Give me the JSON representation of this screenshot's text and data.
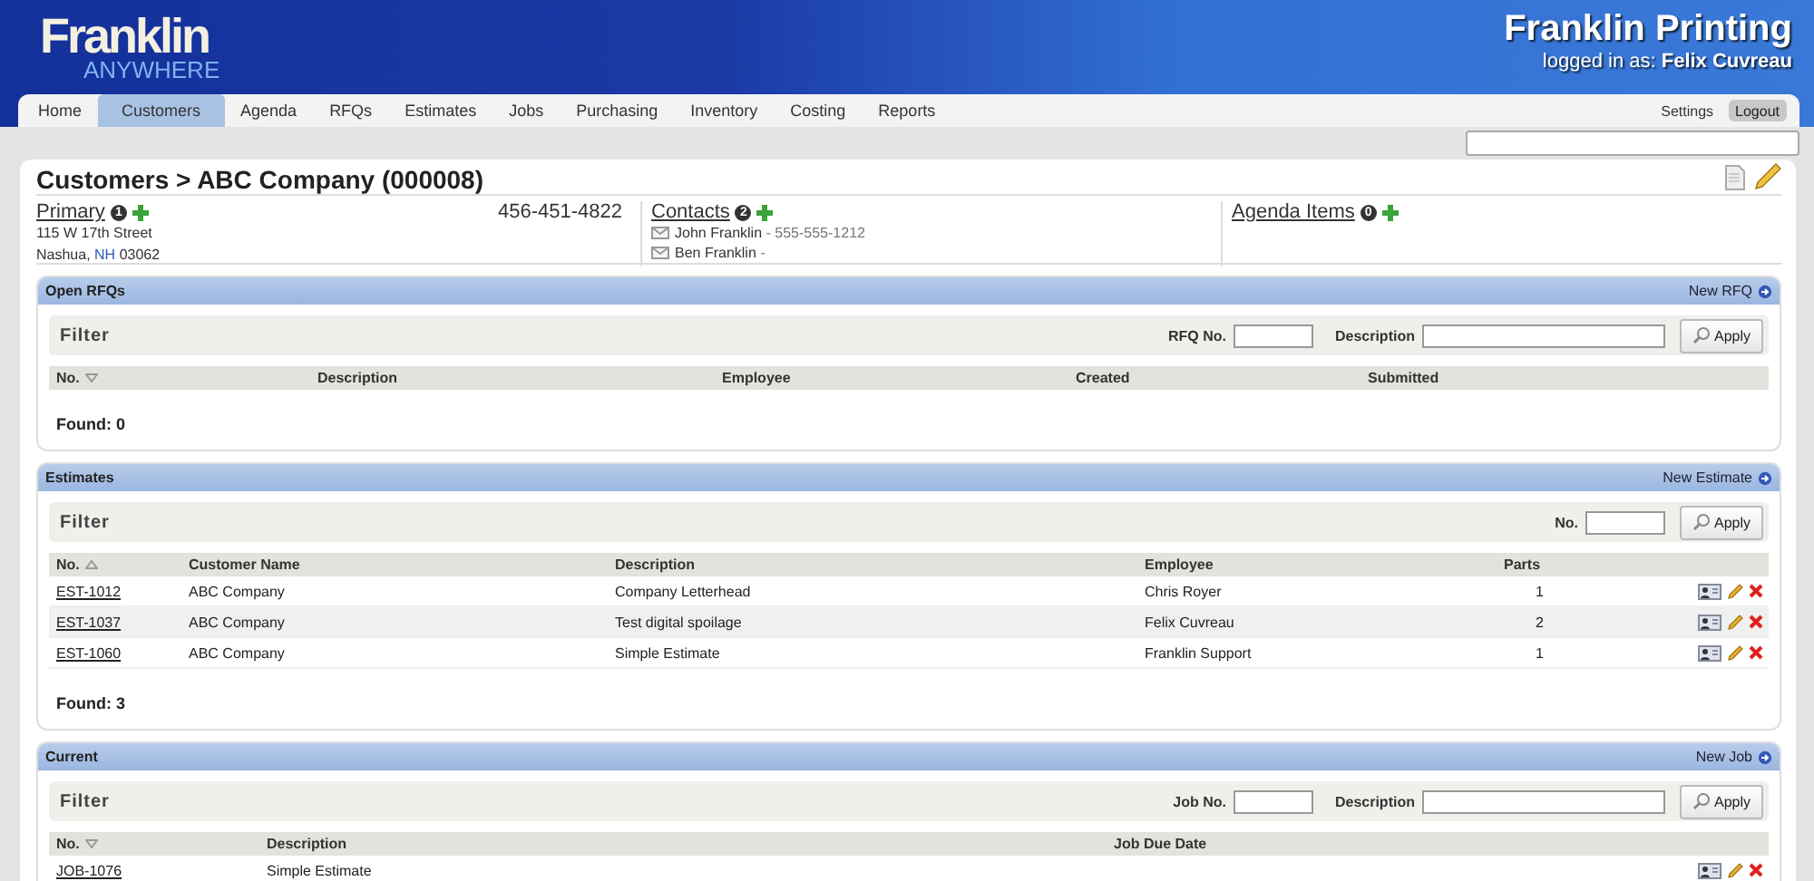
{
  "header": {
    "logo_top": "Franklin",
    "logo_bottom": "ANYWHERE",
    "company": "Franklin Printing",
    "login": "logged in as: **Felix Cuvreau**"
  },
  "nav": {
    "tabs": [
      {
        "label": "Home",
        "selected": false
      },
      {
        "label": "Customers",
        "selected": true
      },
      {
        "label": "Agenda",
        "selected": false
      },
      {
        "label": "RFQs",
        "selected": false
      },
      {
        "label": "Estimates",
        "selected": false
      },
      {
        "label": "Jobs",
        "selected": false
      },
      {
        "label": "Purchasing",
        "selected": false
      },
      {
        "label": "Inventory",
        "selected": false
      },
      {
        "label": "Costing",
        "selected": false
      },
      {
        "label": "Reports",
        "selected": false
      }
    ],
    "settings": "Settings",
    "logout": "Logout"
  },
  "page_title": "Customers > ABC Company (000008)",
  "primary": {
    "label": "Primary",
    "count": "1",
    "address_line1": "115 W 17th Street",
    "city": "Nashua, ",
    "state": "NH",
    "zip": " 03062",
    "phone": "456-451-4822"
  },
  "contacts": {
    "label": "Contacts",
    "count": "2",
    "items": [
      {
        "name": "John Franklin",
        "phone": " - 555-555-1212"
      },
      {
        "name": "Ben Franklin",
        "phone": " -"
      }
    ]
  },
  "agenda": {
    "label": "Agenda Items",
    "count": "0"
  },
  "sections": [
    {
      "kind": "rfq",
      "title": "Open RFQs",
      "action": "New RFQ",
      "filter_title": "Filter",
      "fields": [
        {
          "label": "RFQ No."
        },
        {
          "label": "Description"
        }
      ],
      "apply": "Apply",
      "columns": [
        {
          "label": "No.",
          "sorted_ascending": false
        },
        {
          "label": "Description"
        },
        {
          "label": "Employee"
        },
        {
          "label": "Created"
        },
        {
          "label": "Submitted"
        }
      ],
      "found": "Found: 0"
    },
    {
      "kind": "estimate",
      "title": "Estimates",
      "action": "New Estimate",
      "filter_title": "Filter",
      "fields": [
        {
          "label": "No."
        }
      ],
      "apply": "Apply",
      "columns": [
        {
          "label": "No.",
          "sorted_ascending": true
        },
        {
          "label": "Customer Name"
        },
        {
          "label": "Description"
        },
        {
          "label": "Employee"
        },
        {
          "label": "Parts"
        }
      ],
      "rows": [
        {
          "cells": [
            "EST-1012",
            "ABC Company",
            "Company Letterhead",
            "Chris Royer",
            "1"
          ]
        },
        {
          "cells": [
            "EST-1037",
            "ABC Company",
            "Test digital spoilage",
            "Felix Cuvreau",
            "2"
          ]
        },
        {
          "cells": [
            "EST-1060",
            "ABC Company",
            "Simple Estimate",
            "Franklin Support",
            "1"
          ]
        }
      ],
      "found": "Found: 3"
    },
    {
      "kind": "job",
      "title": "Current",
      "action": "New Job",
      "filter_title": "Filter",
      "fields": [
        {
          "label": "Job No."
        },
        {
          "label": "Description"
        }
      ],
      "apply": "Apply",
      "columns": [
        {
          "label": "No.",
          "sorted_ascending": false
        },
        {
          "label": "Description"
        },
        {
          "label": "Job Due Date"
        }
      ],
      "rows": [
        {
          "cells": [
            "JOB-1076",
            "Simple Estimate"
          ]
        }
      ]
    }
  ]
}
